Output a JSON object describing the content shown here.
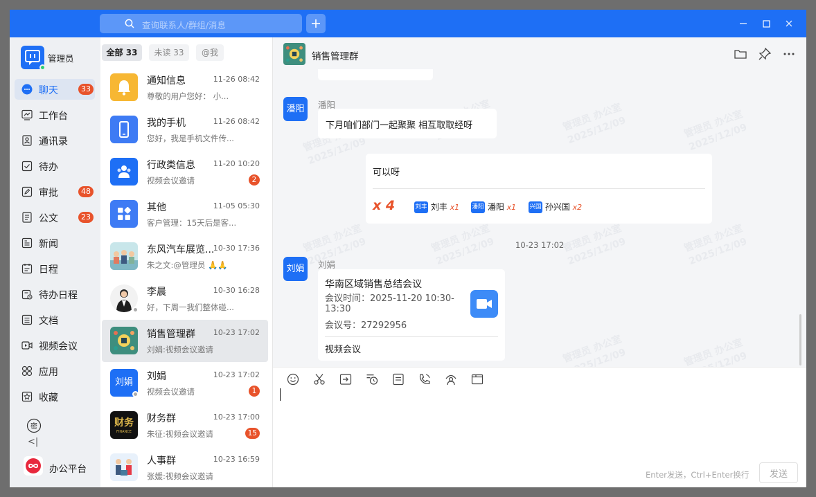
{
  "search": {
    "placeholder": "查询联系人/群组/消息"
  },
  "user": {
    "name": "管理员"
  },
  "nav": {
    "items": [
      {
        "label": "聊天",
        "badge": "33",
        "icon": "chat-icon"
      },
      {
        "label": "工作台",
        "badge": "",
        "icon": "workbench-icon"
      },
      {
        "label": "通讯录",
        "badge": "",
        "icon": "contacts-icon"
      },
      {
        "label": "待办",
        "badge": "",
        "icon": "todo-icon"
      },
      {
        "label": "审批",
        "badge": "48",
        "icon": "approval-icon"
      },
      {
        "label": "公文",
        "badge": "23",
        "icon": "document-icon"
      },
      {
        "label": "新闻",
        "badge": "",
        "icon": "news-icon"
      },
      {
        "label": "日程",
        "badge": "",
        "icon": "calendar-icon"
      },
      {
        "label": "待办日程",
        "badge": "",
        "icon": "todo-calendar-icon"
      },
      {
        "label": "文档",
        "badge": "",
        "icon": "file-icon"
      },
      {
        "label": "视频会议",
        "badge": "",
        "icon": "video-icon"
      },
      {
        "label": "应用",
        "badge": "",
        "icon": "apps-icon"
      },
      {
        "label": "收藏",
        "badge": "",
        "icon": "star-icon"
      }
    ],
    "collapse": "<|",
    "platform": "办公平台"
  },
  "tabs": [
    "全部 33",
    "未读 33",
    "@我"
  ],
  "conversations": [
    {
      "name": "通知信息",
      "time": "11-26 08:42",
      "preview": "尊敬的用户您好： 小...",
      "badge": ""
    },
    {
      "name": "我的手机",
      "time": "11-26 08:42",
      "preview": "您好，我是手机文件传...",
      "badge": ""
    },
    {
      "name": "行政类信息",
      "time": "11-20 10:20",
      "preview": "视频会议邀请",
      "badge": "2"
    },
    {
      "name": "其他",
      "time": "11-05 05:30",
      "preview": "客户管理：15天后是客...",
      "badge": ""
    },
    {
      "name": "东风汽车展览...",
      "time": "10-30 17:36",
      "preview": "朱之文:@管理员 🙏🙏",
      "badge": ""
    },
    {
      "name": "李晨",
      "time": "10-30 16:28",
      "preview": "好，下周一我们整体碰...",
      "badge": ""
    },
    {
      "name": "销售管理群",
      "time": "10-23 17:02",
      "preview": "刘娟:视频会议邀请",
      "badge": ""
    },
    {
      "name": "刘娟",
      "time": "10-23 17:02",
      "preview": "视频会议邀请",
      "badge": "1"
    },
    {
      "name": "财务群",
      "time": "10-23 17:00",
      "preview": "朱征:视频会议邀请",
      "badge": "15"
    },
    {
      "name": "人事群",
      "time": "10-23 16:59",
      "preview": "张媛:视频会议邀请",
      "badge": ""
    }
  ],
  "avatars": {
    "liujuan": "刘娟",
    "caiwu": "财务",
    "caiwu_sub": "FINANCE",
    "panyang": "潘阳"
  },
  "chat": {
    "title": "销售管理群",
    "watermark": {
      "line1": "管理员 办公室",
      "line2": "2025/12/09"
    },
    "msg1": {
      "sender": "潘阳",
      "text": "下月咱们部门一起聚聚 相互取取经呀"
    },
    "msg2": {
      "text": "可以呀",
      "total": "x 4",
      "reactions": [
        {
          "tag": "刘丰",
          "name": "刘丰",
          "count": "x1"
        },
        {
          "tag": "潘阳",
          "name": "潘阳",
          "count": "x1"
        },
        {
          "tag": "兴国",
          "name": "孙兴国",
          "count": "x2"
        }
      ]
    },
    "divider_time": "10-23 17:02",
    "msg3": {
      "sender": "刘娟",
      "title": "华南区域销售总结会议",
      "time_line1": "会议时间：2025-11-20 10:30-",
      "time_line2": "13:30",
      "number": "会议号：27292956",
      "footer": "视频会议"
    }
  },
  "composer": {
    "hint": "Enter发送，Ctrl+Enter换行",
    "send": "发送"
  },
  "colors": {
    "brand": "#1e6ff5",
    "badge": "#e8532b",
    "reaction": "#e8532b"
  }
}
